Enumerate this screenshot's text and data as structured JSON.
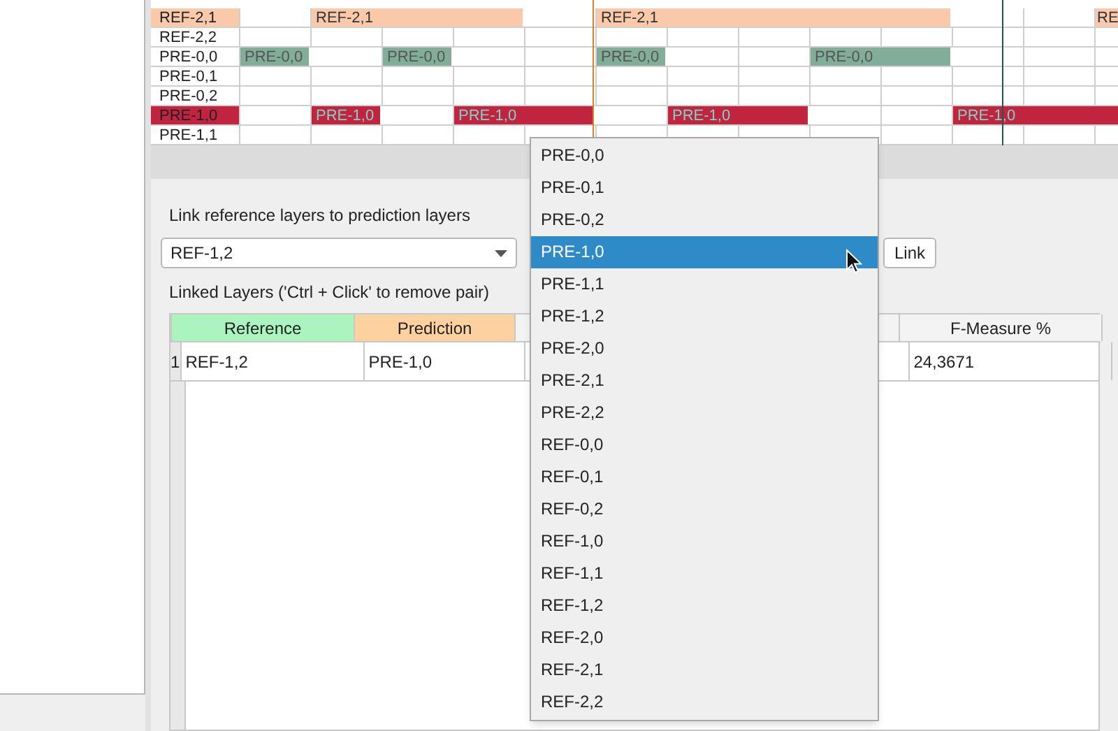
{
  "timeline": {
    "rows": [
      {
        "label": "REF-2,1",
        "color": "#f9c9a9",
        "label_marked": true,
        "cells": [
          {
            "kind": "empty"
          },
          {
            "kind": "bar",
            "label": "REF-2,1"
          },
          {
            "kind": "bar"
          },
          {
            "kind": "bar"
          },
          {
            "kind": "empty"
          },
          {
            "kind": "bar",
            "label": "REF-2,1"
          },
          {
            "kind": "bar"
          },
          {
            "kind": "bar"
          },
          {
            "kind": "bar"
          },
          {
            "kind": "bar"
          },
          {
            "kind": "empty"
          },
          {
            "kind": "empty"
          },
          {
            "kind": "bar",
            "label": "RE"
          }
        ]
      },
      {
        "label": "REF-2,2"
      },
      {
        "label": "PRE-0,0",
        "color": "#82ae99",
        "cells": [
          {
            "kind": "bar",
            "label": "PRE-0,0"
          },
          {
            "kind": "empty"
          },
          {
            "kind": "bar",
            "label": "PRE-0,0"
          },
          {
            "kind": "empty"
          },
          {
            "kind": "empty"
          },
          {
            "kind": "bar",
            "label": "PRE-0,0"
          },
          {
            "kind": "empty"
          },
          {
            "kind": "empty"
          },
          {
            "kind": "bar",
            "label": "PRE-0,0"
          },
          {
            "kind": "bar"
          },
          {
            "kind": "empty"
          },
          {
            "kind": "empty"
          },
          {
            "kind": "empty"
          }
        ]
      },
      {
        "label": "PRE-0,1"
      },
      {
        "label": "PRE-0,2"
      },
      {
        "label": "PRE-1,0",
        "color": "#c0243e",
        "label_marked": true,
        "cells": [
          {
            "kind": "empty"
          },
          {
            "kind": "bar",
            "label": "PRE-1,0"
          },
          {
            "kind": "empty"
          },
          {
            "kind": "bar",
            "label": "PRE-1,0"
          },
          {
            "kind": "bar"
          },
          {
            "kind": "empty"
          },
          {
            "kind": "bar",
            "label": "PRE-1,0"
          },
          {
            "kind": "bar"
          },
          {
            "kind": "empty"
          },
          {
            "kind": "empty"
          },
          {
            "kind": "bar",
            "label": "PRE-1,0"
          },
          {
            "kind": "bar"
          },
          {
            "kind": "bar"
          }
        ]
      },
      {
        "label": "PRE-1,1"
      }
    ]
  },
  "link_panel": {
    "title": "Link reference layers to prediction layers",
    "reference_select": {
      "value": "REF-1,2"
    },
    "link_button": "Link",
    "linked_title": "Linked Layers ('Ctrl + Click' to remove pair)",
    "table": {
      "columns": [
        {
          "label": "Reference",
          "color": "#acf4bf"
        },
        {
          "label": "Prediction",
          "color": "#fdd1a0"
        },
        {
          "label": "F-Measure %"
        }
      ],
      "rows": [
        {
          "index": "1",
          "cells": [
            "REF-1,2",
            "PRE-1,0",
            "24,3671"
          ]
        }
      ]
    }
  },
  "dropdown": {
    "items": [
      {
        "label": "PRE-0,0",
        "selected": false
      },
      {
        "label": "PRE-0,1",
        "selected": false
      },
      {
        "label": "PRE-0,2",
        "selected": false
      },
      {
        "label": "PRE-1,0",
        "selected": true
      },
      {
        "label": "PRE-1,1",
        "selected": false
      },
      {
        "label": "PRE-1,2",
        "selected": false
      },
      {
        "label": "PRE-2,0",
        "selected": false
      },
      {
        "label": "PRE-2,1",
        "selected": false
      },
      {
        "label": "PRE-2,2",
        "selected": false
      },
      {
        "label": "REF-0,0",
        "selected": false
      },
      {
        "label": "REF-0,1",
        "selected": false
      },
      {
        "label": "REF-0,2",
        "selected": false
      },
      {
        "label": "REF-1,0",
        "selected": false
      },
      {
        "label": "REF-1,1",
        "selected": false
      },
      {
        "label": "REF-1,2",
        "selected": false
      },
      {
        "label": "REF-2,0",
        "selected": false
      },
      {
        "label": "REF-2,1",
        "selected": false
      },
      {
        "label": "REF-2,2",
        "selected": false
      }
    ]
  }
}
